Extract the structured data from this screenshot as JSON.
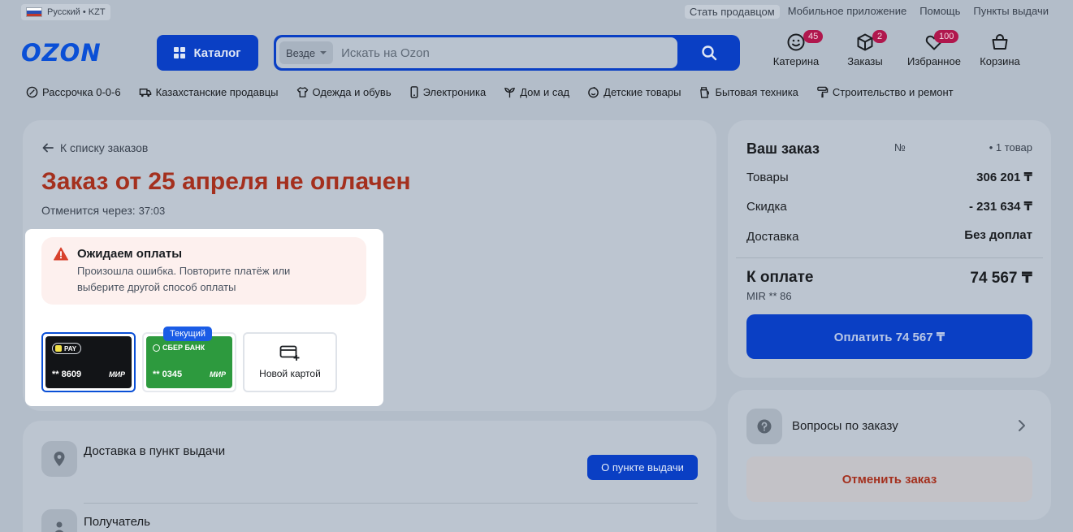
{
  "topbar": {
    "language": "Русский • KZT",
    "links": [
      "Стать продавцом",
      "Мобильное приложение",
      "Помощь",
      "Пункты выдачи"
    ]
  },
  "header": {
    "logo": "OZON",
    "catalog_label": "Каталог",
    "search_scope": "Везде",
    "search_placeholder": "Искать на Ozon",
    "icons": [
      {
        "label": "Катерина",
        "badge": "45",
        "icon": "face-icon"
      },
      {
        "label": "Заказы",
        "badge": "2",
        "icon": "box-icon"
      },
      {
        "label": "Избранное",
        "badge": "100",
        "icon": "heart-icon"
      },
      {
        "label": "Корзина",
        "badge": "",
        "icon": "cart-icon"
      }
    ]
  },
  "categories": [
    "Рассрочка 0-0-6",
    "Казахстанские продавцы",
    "Одежда и обувь",
    "Электроника",
    "Дом и сад",
    "Детские товары",
    "Бытовая техника",
    "Строительство и ремонт"
  ],
  "order": {
    "back_link": "К списку заказов",
    "title": "Заказ от 25 апреля не оплачен",
    "cancel_in_label": "Отменится через:",
    "cancel_in_time": "37:03",
    "warning_title": "Ожидаем оплаты",
    "warning_text": "Произошла ошибка. Повторите платёж или выберите другой способ оплаты",
    "payment_cards": [
      {
        "brand": "PAY",
        "number": "** 8609",
        "system": "МИР"
      },
      {
        "brand": "СБЕР БАНК",
        "number": "** 0345",
        "system": "МИР"
      }
    ],
    "current_tag": "Текущий",
    "new_card_label": "Новой картой",
    "delivery_title": "Доставка в пункт выдачи",
    "pickup_button": "О пункте выдачи",
    "recipient_title": "Получатель"
  },
  "summary": {
    "title": "Ваш заказ",
    "number_label": "№",
    "item_count": "• 1 товар",
    "rows": [
      {
        "label": "Товары",
        "value": "306 201 ₸"
      },
      {
        "label": "Скидка",
        "value": "- 231 634 ₸"
      },
      {
        "label": "Доставка",
        "value": "Без доплат"
      }
    ],
    "pay_label": "К оплате",
    "pay_amount": "74 567 ₸",
    "pay_method": "MIR ** 86",
    "pay_button": "Оплатить 74 567 ₸",
    "questions": "Вопросы по заказу",
    "cancel_button": "Отменить заказ"
  },
  "colors": {
    "accent": "#0a3fc4",
    "logo": "#0a4fd6",
    "danger": "#a4301e",
    "badge": "#b0174d"
  }
}
